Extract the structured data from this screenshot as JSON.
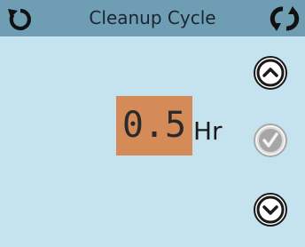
{
  "header": {
    "title": "Cleanup Cycle"
  },
  "display": {
    "value": "0.5",
    "unit": "Hr"
  },
  "icons": {
    "back": "back-arrow-icon",
    "cycle": "cycle-arrows-icon",
    "up": "chevron-up-icon",
    "ok": "checkmark-icon",
    "down": "chevron-down-icon"
  },
  "colors": {
    "background": "#c5e3ef",
    "title_bar": "#6f9db4",
    "value_highlight": "#d48b58"
  },
  "state": {
    "ok_button_enabled": false
  }
}
